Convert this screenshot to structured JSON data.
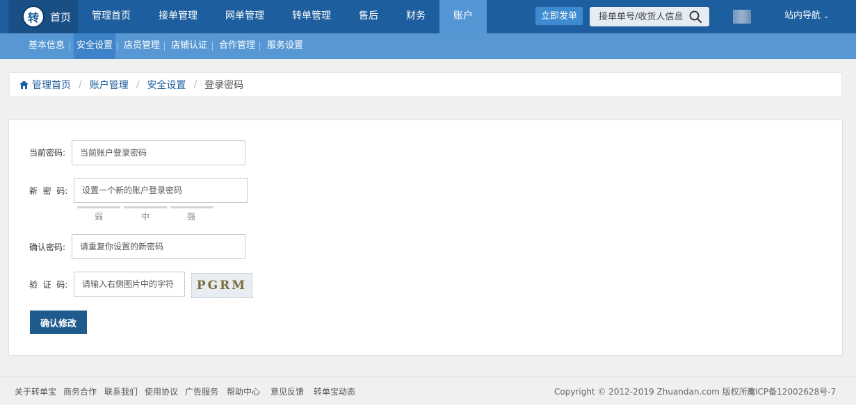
{
  "topnav": {
    "logo_char": "转",
    "logo_label": "首页",
    "items": [
      "管理首页",
      "接单管理",
      "网单管理",
      "转单管理",
      "售后",
      "财务",
      "账户"
    ],
    "order_button": "立即发单",
    "search_placeholder": "接单单号/收货人信息",
    "site_nav": "站内导航"
  },
  "subnav": {
    "items": [
      "基本信息",
      "安全设置",
      "店员管理",
      "店铺认证",
      "合作管理",
      "服务设置"
    ]
  },
  "breadcrumb": {
    "items": [
      "管理首页",
      "账户管理",
      "安全设置"
    ],
    "current": "登录密码"
  },
  "form": {
    "current_label": "当前密码:",
    "current_placeholder": "当前账户登录密码",
    "new_label": "新  密  码:",
    "new_placeholder": "设置一个新的账户登录密码",
    "strength": [
      "弱",
      "中",
      "强"
    ],
    "confirm_label": "确认密码:",
    "confirm_placeholder": "请重复你设置的新密码",
    "captcha_label": "验  证  码:",
    "captcha_placeholder": "请输入右侧图片中的字符",
    "captcha_text": "PGRM",
    "submit": "确认修改"
  },
  "footer": {
    "links": [
      "关于转单宝",
      "商务合作",
      "联系我们",
      "使用协议",
      "广告服务",
      "帮助中心",
      "意见反馈",
      "转单宝动态"
    ],
    "copyright": "Copyright © 2012-2019 Zhuandan.com 版权所有",
    "icp": "渝ICP备12002628号-7"
  },
  "colors": {
    "topbar": "#1d5e9e",
    "subbar": "#5798d4",
    "active_tab": "#5396d4",
    "submit_button": "#1f5c8d"
  }
}
